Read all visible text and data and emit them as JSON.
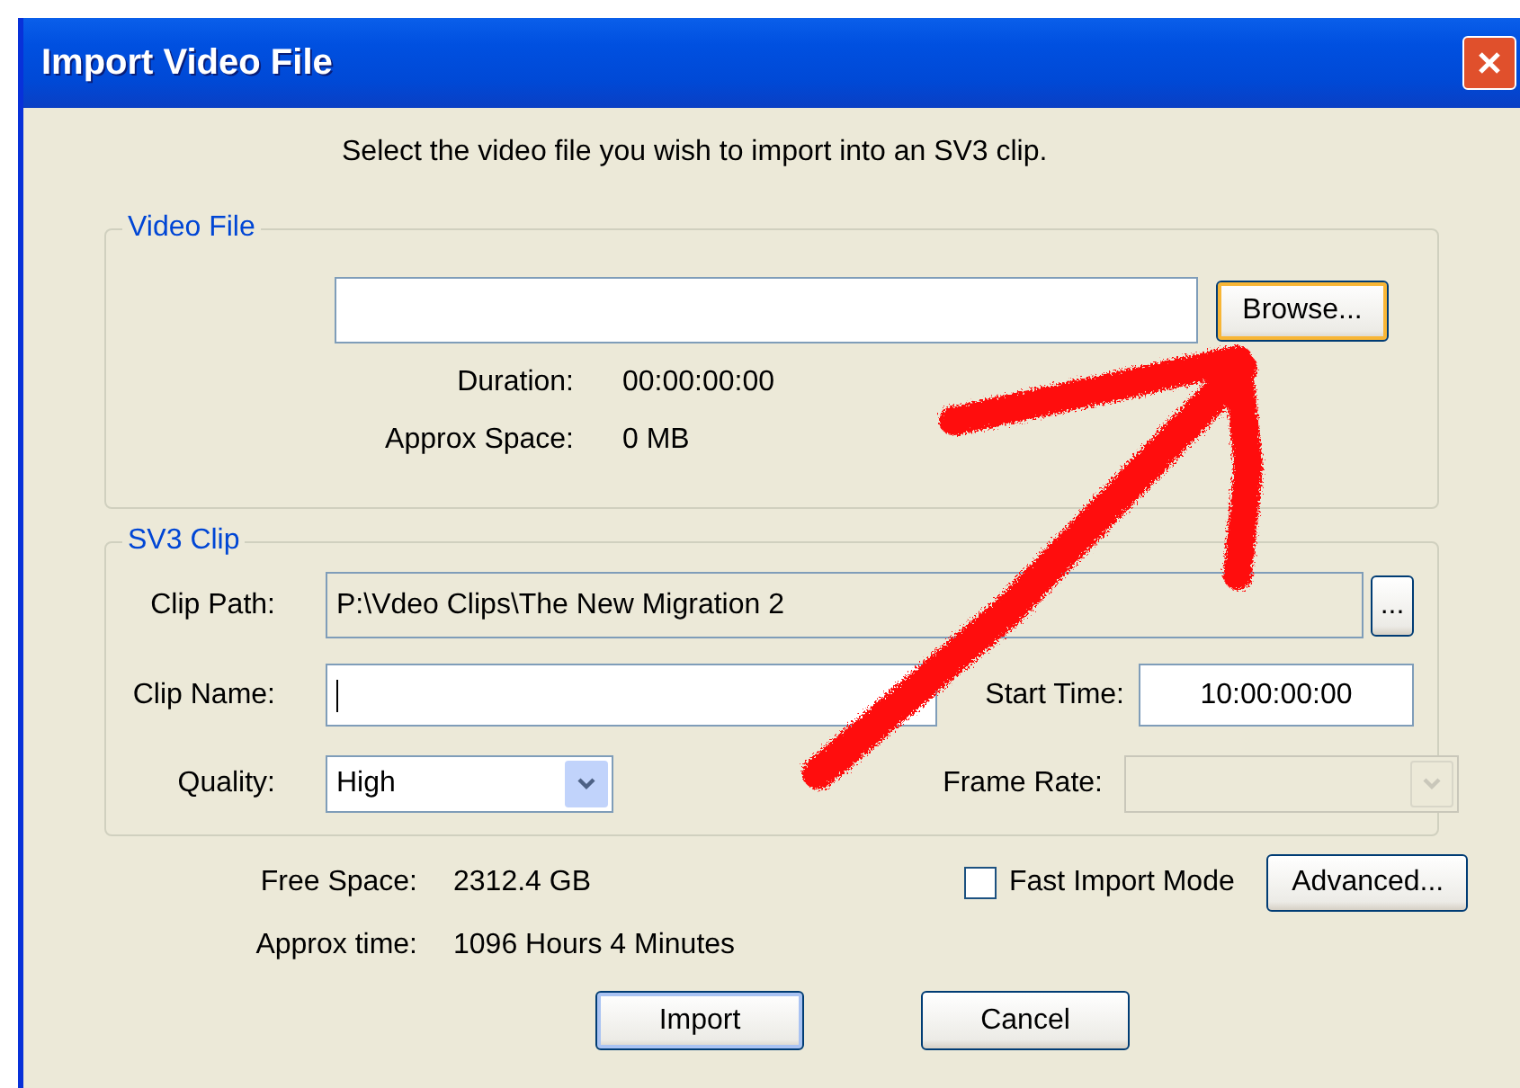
{
  "window": {
    "title": "Import Video File"
  },
  "instruction": "Select the video file you wish to import into an SV3 clip.",
  "video_file": {
    "legend": "Video File",
    "browse_button": {
      "label": "Browse...",
      "highlighted": true
    },
    "info": [
      {
        "label": "Duration:",
        "value": "00:00:00:00"
      },
      {
        "label": "Approx Space:",
        "value": "0 MB"
      }
    ]
  },
  "sv3_clip": {
    "legend": "SV3 Clip",
    "clip_path": {
      "label": "Clip Path:",
      "value": "P:\\Vdeo Clips\\The New Migration 2",
      "disabled": true,
      "browse_button": "..."
    },
    "clip_name": {
      "label": "Clip Name:",
      "focused": true
    },
    "start_time": {
      "label": "Start Time:",
      "value": "10:00:00:00"
    },
    "quality": {
      "label": "Quality:",
      "value": "High",
      "disabled": false
    },
    "frame_rate": {
      "label": "Frame Rate:",
      "disabled": true
    }
  },
  "free_space": {
    "label": "Free Space:",
    "value": "2312.4 GB"
  },
  "approx_time": {
    "label": "Approx time:",
    "value": "1096 Hours 4 Minutes"
  },
  "fast_import_mode": {
    "label": "Fast Import Mode",
    "checked": false
  },
  "advanced_button": "Advanced...",
  "buttons": [
    {
      "label": "Import",
      "default": true
    },
    {
      "label": "Cancel",
      "default": false
    }
  ]
}
